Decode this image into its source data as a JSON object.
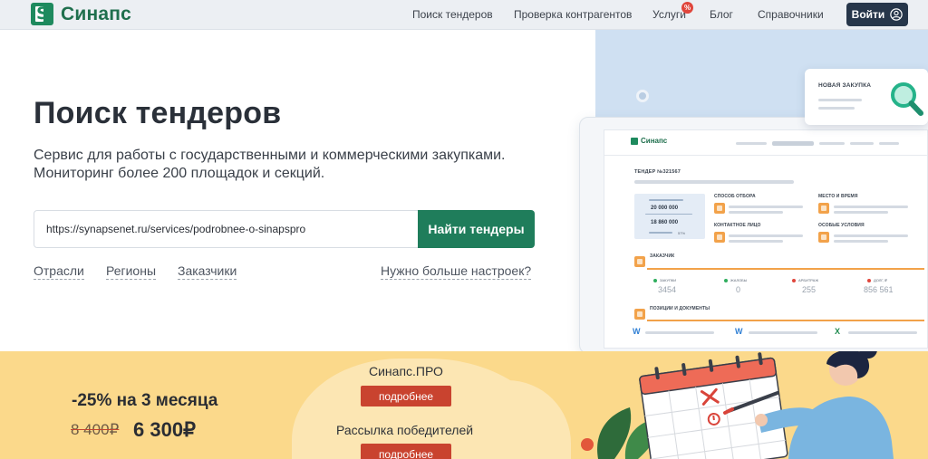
{
  "header": {
    "logo_text": "Синапс",
    "nav": [
      "Поиск тендеров",
      "Проверка контрагентов",
      "Услуги",
      "Блог",
      "Справочники"
    ],
    "services_badge": "%",
    "login_label": "Войти"
  },
  "hero": {
    "title": "Поиск тендеров",
    "subtitle_line1": "Сервис для работы с государственными и коммерческими закупками.",
    "subtitle_line2": "Мониторинг более 200 площадок и секций.",
    "search_value": "https://synapsenet.ru/services/podrobnee-o-sinapspro",
    "search_button": "Найти тендеры",
    "filters": [
      "Отрасли",
      "Регионы",
      "Заказчики"
    ],
    "more_settings": "Нужно больше настроек?"
  },
  "illustration": {
    "new_purchase": "НОВАЯ ЗАКУПКА",
    "mini_logo": "Синапс",
    "tender_no": "ТЕНДЕР №321567",
    "price_top": "20 000 000",
    "price_bottom": "18 860 000",
    "price_pct": "57%",
    "labels": {
      "selection": "СПОСОБ ОТБОРА",
      "place_time": "МЕСТО И ВРЕМЯ",
      "contact": "КОНТАКТНОЕ ЛИЦО",
      "special": "ОСОБЫЕ УСЛОВИЯ",
      "customer": "ЗАКАЗЧИК",
      "positions": "ПОЗИЦИИ И ДОКУМЕНТЫ"
    },
    "stats": [
      {
        "label": "ЗАКУПКИ",
        "value": "3454",
        "color": "#2fae5d"
      },
      {
        "label": "ЖАЛОБЫ",
        "value": "0",
        "color": "#2fae5d"
      },
      {
        "label": "АРБИТРАЖ",
        "value": "255",
        "color": "#e0463c"
      },
      {
        "label": "ДОЛГ, ₽",
        "value": "856 561",
        "color": "#e0463c"
      }
    ],
    "doc_icons": [
      "W",
      "W",
      "X"
    ]
  },
  "promo": {
    "discount": "-25% на 3 месяца",
    "old_price": "8 400₽",
    "new_price": "6 300₽",
    "product1_title": "Синапс.ПРО",
    "product1_button": "подробнее",
    "product2_title": "Рассылка победителей",
    "product2_button": "подробнее"
  },
  "colors": {
    "brand_green": "#1f7d5b",
    "login_dark": "#26364a",
    "promo_bg": "#fbd98b",
    "promo_button": "#c9432f",
    "accent_orange": "#f2a24a"
  }
}
